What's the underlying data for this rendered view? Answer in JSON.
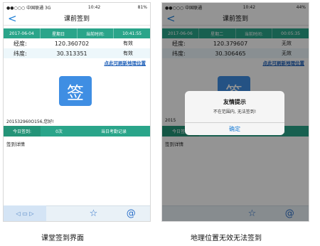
{
  "left": {
    "status": {
      "carrier": "●●○○○ 中国联通",
      "signal_type": "3G",
      "time": "10:42",
      "battery": "81%"
    },
    "nav": {
      "back": "<",
      "title": "课前签到"
    },
    "date_row": [
      "2017-06-04",
      "星期日",
      "当前时间:",
      "10:41:55"
    ],
    "longitude": {
      "label": "经度:",
      "value": "120.360702",
      "status": "有效"
    },
    "latitude": {
      "label": "纬度:",
      "value": "30.313351",
      "status": "有效"
    },
    "refresh_link": "点此可刷新地理位置",
    "sign_button": "签",
    "greeting": "201532960O156,您好!",
    "today": {
      "label": "今日签到:",
      "count": "0次",
      "records": "当日考勤记录"
    },
    "detail": "签到详情",
    "tabs": {
      "star": "☆",
      "at": "@",
      "nav_strip": "◁ ▭ ▷"
    }
  },
  "right": {
    "status": {
      "carrier": "●●○○○ 中国联通",
      "time": "10:42",
      "battery": "44%"
    },
    "nav": {
      "back": "<",
      "title": "课前签到"
    },
    "date_row": [
      "2017-06-06",
      "星期二",
      "当前时间:",
      "00:05:35"
    ],
    "longitude": {
      "label": "经度:",
      "value": "120.379607",
      "status": "无效"
    },
    "latitude": {
      "label": "纬度:",
      "value": "30.306465",
      "status": "无效"
    },
    "refresh_link": "点此可刷新地理位置",
    "sign_button": "签",
    "greeting": "2015",
    "today": {
      "label": "今日签到",
      "count": "0次",
      "records": "当日考勤记录"
    },
    "detail": "签到详情",
    "alert": {
      "title": "友情提示",
      "message": "不在范围内, 无法签到!",
      "ok": "确定"
    },
    "tabs": {
      "star": "☆",
      "at": "@"
    }
  },
  "captions": {
    "left": "课堂签到界面",
    "right": "地理位置无效无法签到"
  },
  "colors": {
    "accent_green": "#2aa58a",
    "sign_blue": "#3f8ee3",
    "link_blue": "#1e5fb8"
  }
}
